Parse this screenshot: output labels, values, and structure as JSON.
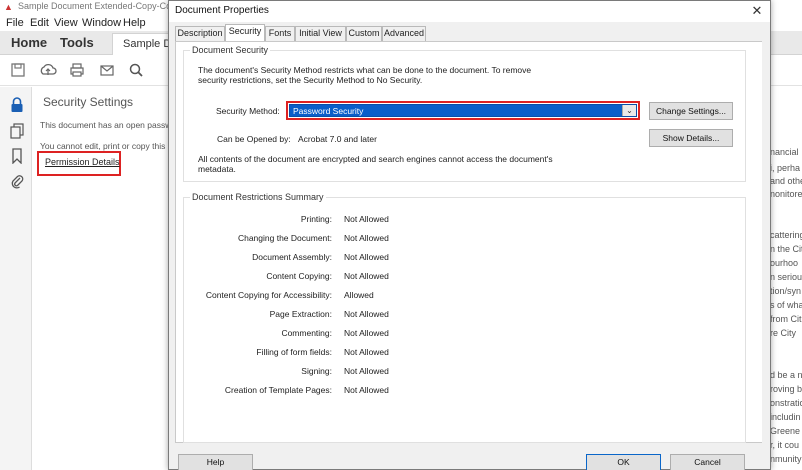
{
  "app": {
    "window_title": "Sample Document Extended-Copy-Co",
    "menu": [
      "File",
      "Edit",
      "View",
      "Window",
      "Help"
    ],
    "tabs": {
      "home": "Home",
      "tools": "Tools",
      "document": "Sample Do"
    },
    "toolbar_icons": [
      "save-icon",
      "upload-icon",
      "print-icon",
      "email-icon",
      "search-icon"
    ],
    "left_rail_icons": [
      "lock-icon",
      "pages-icon",
      "bookmark-icon",
      "attachment-icon"
    ],
    "security_panel": {
      "title": "Security Settings",
      "line1": "This document has an open passwo",
      "line2": "You cannot edit, print or copy this",
      "permission_link": "Permission Details"
    },
    "doc_fragments": [
      "nancial",
      "i, perha",
      "and othe",
      "nonitore",
      "cattering",
      "n the Cit",
      "ourhoo",
      "n seriou",
      "tion/syn",
      "s of wha",
      "from Cit",
      "re City",
      "d be a n",
      "roving b",
      "onstratio",
      "includin",
      "Greene",
      "r, it cou",
      "nmunity"
    ]
  },
  "dialog": {
    "title": "Document Properties",
    "close_glyph": "✕",
    "tabs": [
      "Description",
      "Security",
      "Fonts",
      "Initial View",
      "Custom",
      "Advanced"
    ],
    "active_tab": "Security",
    "security_group": {
      "label": "Document Security",
      "intro_line1": "The document's Security Method restricts what can be done to the document. To remove",
      "intro_line2": "security restrictions, set the Security Method to No Security.",
      "method_label": "Security Method:",
      "method_value": "Password Security",
      "change_button": "Change Settings...",
      "opened_label": "Can be Opened by:",
      "opened_value": "Acrobat 7.0 and later",
      "show_button": "Show Details...",
      "note_line1": "All contents of the document are encrypted and search engines cannot access the document's",
      "note_line2": "metadata."
    },
    "restrictions_group": {
      "label": "Document Restrictions Summary",
      "rows": [
        {
          "label": "Printing:",
          "value": "Not Allowed"
        },
        {
          "label": "Changing the Document:",
          "value": "Not Allowed"
        },
        {
          "label": "Document Assembly:",
          "value": "Not Allowed"
        },
        {
          "label": "Content Copying:",
          "value": "Not Allowed"
        },
        {
          "label": "Content Copying for Accessibility:",
          "value": "Allowed"
        },
        {
          "label": "Page Extraction:",
          "value": "Not Allowed"
        },
        {
          "label": "Commenting:",
          "value": "Not Allowed"
        },
        {
          "label": "Filling of form fields:",
          "value": "Not Allowed"
        },
        {
          "label": "Signing:",
          "value": "Not Allowed"
        },
        {
          "label": "Creation of Template Pages:",
          "value": "Not Allowed"
        }
      ]
    },
    "buttons": {
      "help": "Help",
      "ok": "OK",
      "cancel": "Cancel"
    }
  },
  "colors": {
    "highlight": "#d22222",
    "selection": "#0a5ec9"
  }
}
